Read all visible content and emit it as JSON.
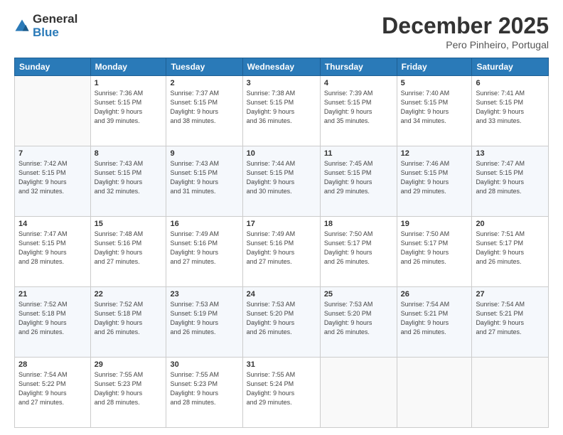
{
  "logo": {
    "general": "General",
    "blue": "Blue"
  },
  "header": {
    "month_title": "December 2025",
    "subtitle": "Pero Pinheiro, Portugal"
  },
  "weekdays": [
    "Sunday",
    "Monday",
    "Tuesday",
    "Wednesday",
    "Thursday",
    "Friday",
    "Saturday"
  ],
  "weeks": [
    [
      {
        "day": "",
        "sunrise": "",
        "sunset": "",
        "daylight": ""
      },
      {
        "day": "1",
        "sunrise": "Sunrise: 7:36 AM",
        "sunset": "Sunset: 5:15 PM",
        "daylight": "Daylight: 9 hours and 39 minutes."
      },
      {
        "day": "2",
        "sunrise": "Sunrise: 7:37 AM",
        "sunset": "Sunset: 5:15 PM",
        "daylight": "Daylight: 9 hours and 38 minutes."
      },
      {
        "day": "3",
        "sunrise": "Sunrise: 7:38 AM",
        "sunset": "Sunset: 5:15 PM",
        "daylight": "Daylight: 9 hours and 36 minutes."
      },
      {
        "day": "4",
        "sunrise": "Sunrise: 7:39 AM",
        "sunset": "Sunset: 5:15 PM",
        "daylight": "Daylight: 9 hours and 35 minutes."
      },
      {
        "day": "5",
        "sunrise": "Sunrise: 7:40 AM",
        "sunset": "Sunset: 5:15 PM",
        "daylight": "Daylight: 9 hours and 34 minutes."
      },
      {
        "day": "6",
        "sunrise": "Sunrise: 7:41 AM",
        "sunset": "Sunset: 5:15 PM",
        "daylight": "Daylight: 9 hours and 33 minutes."
      }
    ],
    [
      {
        "day": "7",
        "sunrise": "Sunrise: 7:42 AM",
        "sunset": "Sunset: 5:15 PM",
        "daylight": "Daylight: 9 hours and 32 minutes."
      },
      {
        "day": "8",
        "sunrise": "Sunrise: 7:43 AM",
        "sunset": "Sunset: 5:15 PM",
        "daylight": "Daylight: 9 hours and 32 minutes."
      },
      {
        "day": "9",
        "sunrise": "Sunrise: 7:43 AM",
        "sunset": "Sunset: 5:15 PM",
        "daylight": "Daylight: 9 hours and 31 minutes."
      },
      {
        "day": "10",
        "sunrise": "Sunrise: 7:44 AM",
        "sunset": "Sunset: 5:15 PM",
        "daylight": "Daylight: 9 hours and 30 minutes."
      },
      {
        "day": "11",
        "sunrise": "Sunrise: 7:45 AM",
        "sunset": "Sunset: 5:15 PM",
        "daylight": "Daylight: 9 hours and 29 minutes."
      },
      {
        "day": "12",
        "sunrise": "Sunrise: 7:46 AM",
        "sunset": "Sunset: 5:15 PM",
        "daylight": "Daylight: 9 hours and 29 minutes."
      },
      {
        "day": "13",
        "sunrise": "Sunrise: 7:47 AM",
        "sunset": "Sunset: 5:15 PM",
        "daylight": "Daylight: 9 hours and 28 minutes."
      }
    ],
    [
      {
        "day": "14",
        "sunrise": "Sunrise: 7:47 AM",
        "sunset": "Sunset: 5:15 PM",
        "daylight": "Daylight: 9 hours and 28 minutes."
      },
      {
        "day": "15",
        "sunrise": "Sunrise: 7:48 AM",
        "sunset": "Sunset: 5:16 PM",
        "daylight": "Daylight: 9 hours and 27 minutes."
      },
      {
        "day": "16",
        "sunrise": "Sunrise: 7:49 AM",
        "sunset": "Sunset: 5:16 PM",
        "daylight": "Daylight: 9 hours and 27 minutes."
      },
      {
        "day": "17",
        "sunrise": "Sunrise: 7:49 AM",
        "sunset": "Sunset: 5:16 PM",
        "daylight": "Daylight: 9 hours and 27 minutes."
      },
      {
        "day": "18",
        "sunrise": "Sunrise: 7:50 AM",
        "sunset": "Sunset: 5:17 PM",
        "daylight": "Daylight: 9 hours and 26 minutes."
      },
      {
        "day": "19",
        "sunrise": "Sunrise: 7:50 AM",
        "sunset": "Sunset: 5:17 PM",
        "daylight": "Daylight: 9 hours and 26 minutes."
      },
      {
        "day": "20",
        "sunrise": "Sunrise: 7:51 AM",
        "sunset": "Sunset: 5:17 PM",
        "daylight": "Daylight: 9 hours and 26 minutes."
      }
    ],
    [
      {
        "day": "21",
        "sunrise": "Sunrise: 7:52 AM",
        "sunset": "Sunset: 5:18 PM",
        "daylight": "Daylight: 9 hours and 26 minutes."
      },
      {
        "day": "22",
        "sunrise": "Sunrise: 7:52 AM",
        "sunset": "Sunset: 5:18 PM",
        "daylight": "Daylight: 9 hours and 26 minutes."
      },
      {
        "day": "23",
        "sunrise": "Sunrise: 7:53 AM",
        "sunset": "Sunset: 5:19 PM",
        "daylight": "Daylight: 9 hours and 26 minutes."
      },
      {
        "day": "24",
        "sunrise": "Sunrise: 7:53 AM",
        "sunset": "Sunset: 5:20 PM",
        "daylight": "Daylight: 9 hours and 26 minutes."
      },
      {
        "day": "25",
        "sunrise": "Sunrise: 7:53 AM",
        "sunset": "Sunset: 5:20 PM",
        "daylight": "Daylight: 9 hours and 26 minutes."
      },
      {
        "day": "26",
        "sunrise": "Sunrise: 7:54 AM",
        "sunset": "Sunset: 5:21 PM",
        "daylight": "Daylight: 9 hours and 26 minutes."
      },
      {
        "day": "27",
        "sunrise": "Sunrise: 7:54 AM",
        "sunset": "Sunset: 5:21 PM",
        "daylight": "Daylight: 9 hours and 27 minutes."
      }
    ],
    [
      {
        "day": "28",
        "sunrise": "Sunrise: 7:54 AM",
        "sunset": "Sunset: 5:22 PM",
        "daylight": "Daylight: 9 hours and 27 minutes."
      },
      {
        "day": "29",
        "sunrise": "Sunrise: 7:55 AM",
        "sunset": "Sunset: 5:23 PM",
        "daylight": "Daylight: 9 hours and 28 minutes."
      },
      {
        "day": "30",
        "sunrise": "Sunrise: 7:55 AM",
        "sunset": "Sunset: 5:23 PM",
        "daylight": "Daylight: 9 hours and 28 minutes."
      },
      {
        "day": "31",
        "sunrise": "Sunrise: 7:55 AM",
        "sunset": "Sunset: 5:24 PM",
        "daylight": "Daylight: 9 hours and 29 minutes."
      },
      {
        "day": "",
        "sunrise": "",
        "sunset": "",
        "daylight": ""
      },
      {
        "day": "",
        "sunrise": "",
        "sunset": "",
        "daylight": ""
      },
      {
        "day": "",
        "sunrise": "",
        "sunset": "",
        "daylight": ""
      }
    ]
  ]
}
